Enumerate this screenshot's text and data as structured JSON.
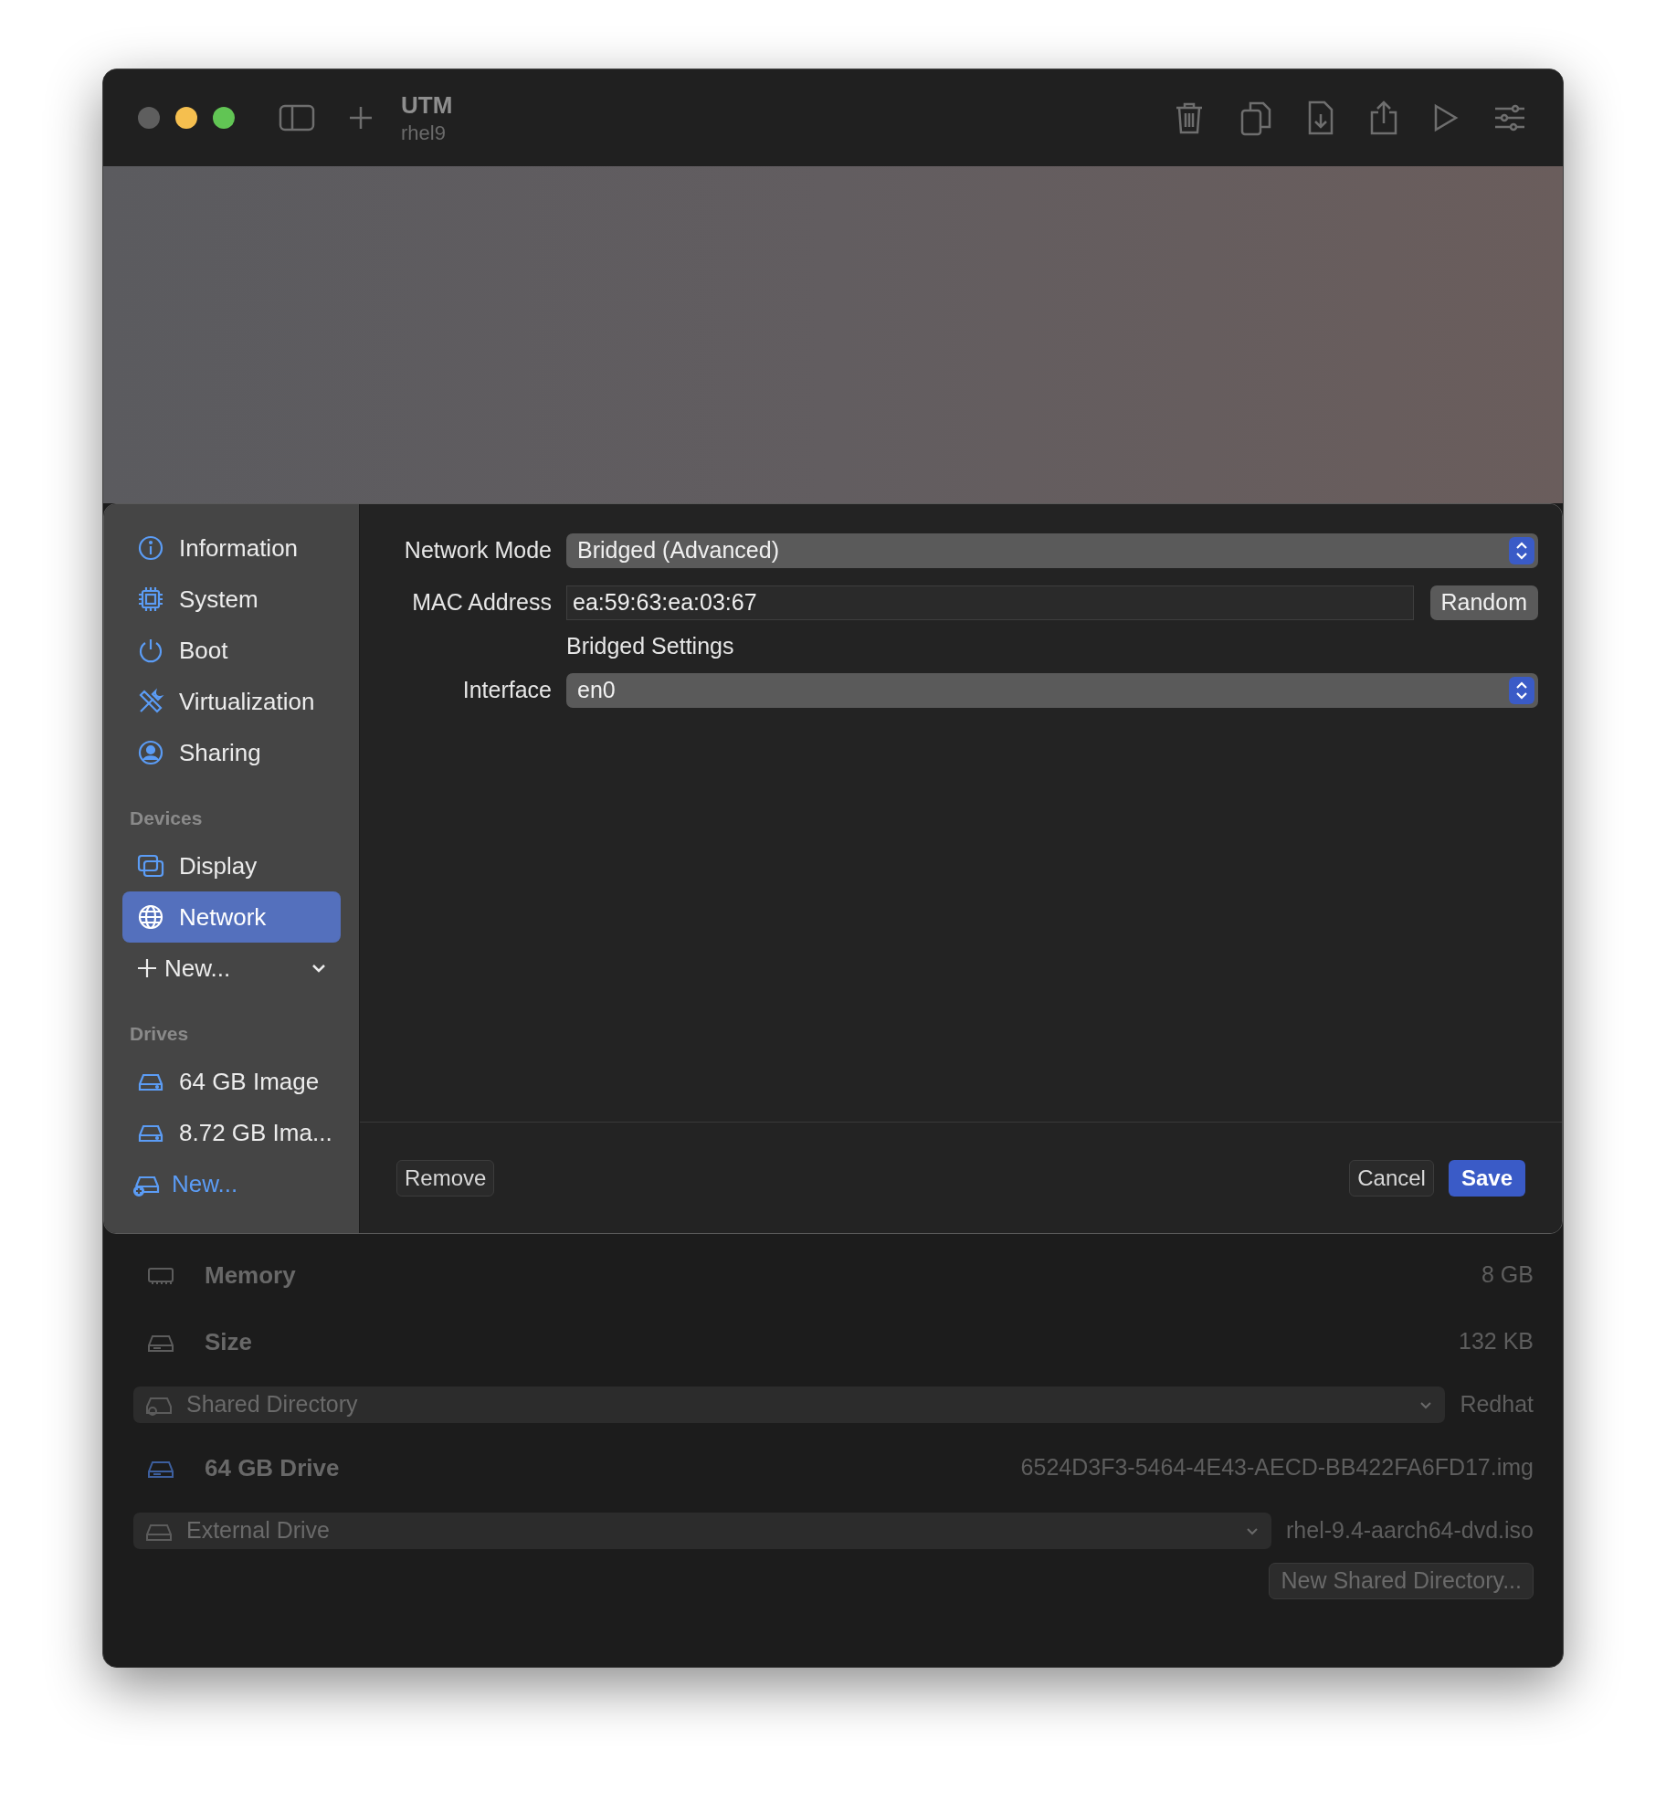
{
  "window": {
    "title": "UTM",
    "subtitle": "rhel9"
  },
  "sidebar": {
    "sections": [
      {
        "items": [
          {
            "kind": "item",
            "label": "Information",
            "selected": false
          },
          {
            "kind": "item",
            "label": "System",
            "selected": false
          },
          {
            "kind": "item",
            "label": "Boot",
            "selected": false
          },
          {
            "kind": "item",
            "label": "Virtualization",
            "selected": false
          },
          {
            "kind": "item",
            "label": "Sharing",
            "selected": false
          }
        ]
      },
      {
        "title": "Devices",
        "items": [
          {
            "kind": "item",
            "label": "Display",
            "selected": false
          },
          {
            "kind": "item",
            "label": "Network",
            "selected": true
          },
          {
            "kind": "add_menu",
            "label": "New..."
          }
        ]
      },
      {
        "title": "Drives",
        "items": [
          {
            "kind": "item",
            "label": "64 GB Image",
            "selected": false
          },
          {
            "kind": "item",
            "label": "8.72 GB Ima...",
            "selected": false
          },
          {
            "kind": "add_link",
            "label": "New..."
          }
        ]
      }
    ]
  },
  "settings": [
    {
      "kind": "select",
      "label": "Network Mode",
      "value": "Bridged (Advanced)"
    },
    {
      "kind": "text",
      "label": "MAC Address",
      "value": "ea:59:63:ea:03:67",
      "button": "Random"
    },
    {
      "kind": "heading",
      "label": "Bridged Settings"
    },
    {
      "kind": "select",
      "label": "Interface",
      "value": "en0"
    }
  ],
  "footer": {
    "remove": "Remove",
    "cancel": "Cancel",
    "save": "Save"
  },
  "details": [
    {
      "kind": "info",
      "label": "Memory",
      "value": "8 GB"
    },
    {
      "kind": "info",
      "label": "Size",
      "value": "132 KB"
    },
    {
      "kind": "dropdown",
      "label": "Shared Directory",
      "value": "Redhat"
    },
    {
      "kind": "info",
      "label": "64 GB Drive",
      "value": "6524D3F3-5464-4E43-AECD-BB422FA6FD17.img"
    },
    {
      "kind": "dropdown",
      "label": "External Drive",
      "value": "rhel-9.4-aarch64-dvd.iso"
    }
  ],
  "new_shared_directory": "New Shared Directory..."
}
